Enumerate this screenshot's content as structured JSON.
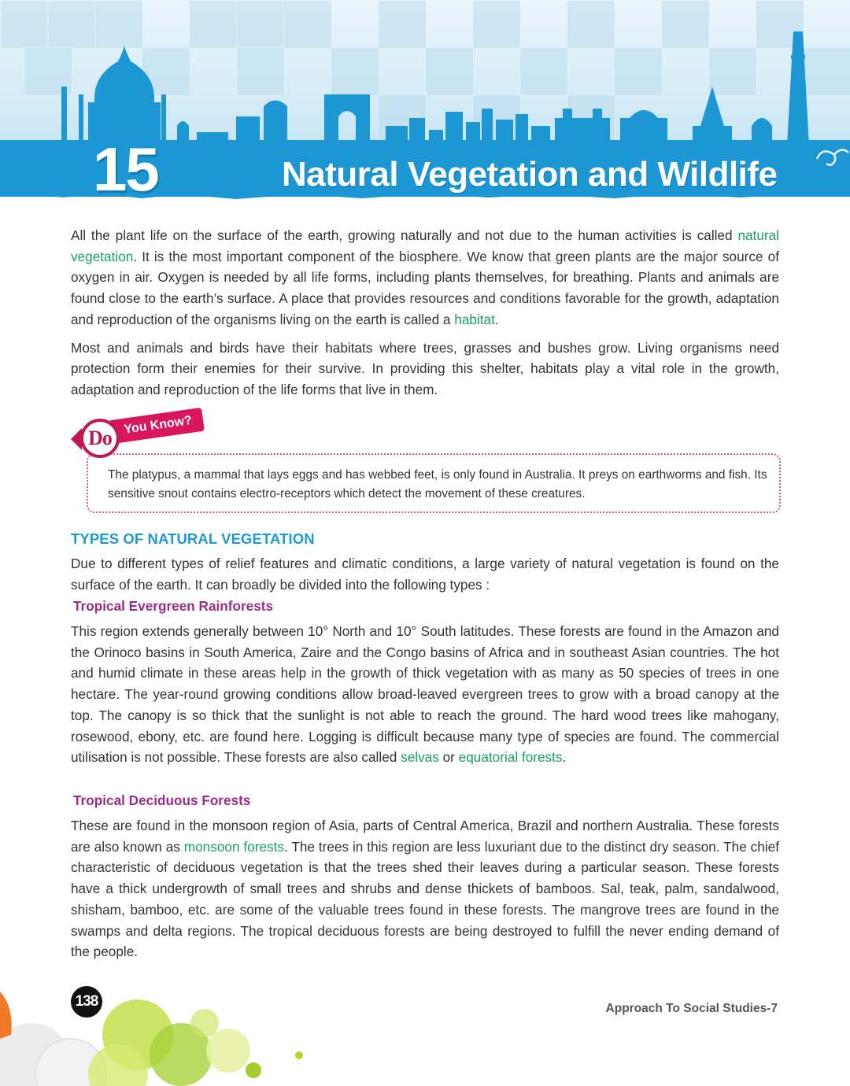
{
  "header": {
    "chapter_number": "15",
    "chapter_title": "Natural Vegetation and Wildlife"
  },
  "intro": {
    "p1_before": "All the plant life on the surface of the earth, growing naturally and not due to the human activities is called ",
    "p1_term1": "natural vegetation",
    "p1_middle": ". It is the most important component of the biosphere. We know that green plants are the major source of oxygen in air. Oxygen is needed by all life forms, including plants themselves, for breathing. Plants and animals are found close to the earth’s surface. A place that provides resources and conditions favorable for the growth, adaptation and reproduction of the organisms living on the earth is called a ",
    "p1_term2": "habitat",
    "p1_end": ".",
    "p2": "Most and animals and birds have their habitats where trees, grasses and bushes grow. Living organisms need protection form their enemies for their survive. In providing this shelter, habitats play a vital role in the growth, adaptation and reproduction of the life forms that live in them."
  },
  "do_you_know": {
    "badge_do": "Do",
    "badge_rest": "You Know?",
    "text": "The platypus, a mammal that lays eggs and has webbed feet, is only found in Australia. It preys on earthworms and fish. Its sensitive snout contains electro-receptors which detect the movement of these creatures."
  },
  "types": {
    "heading": "TYPES OF NATURAL VEGETATION",
    "intro": "Due to different types of relief features and climatic conditions, a large variety of natural vegetation is found on the surface of the earth. It can broadly be divided into the following types :",
    "tropical_evergreen": {
      "heading": "Tropical Evergreen Rainforests",
      "text_before": "This region extends generally between 10° North and 10° South latitudes. These forests are found in the Amazon and the Orinoco basins in South America, Zaire and the Congo basins of Africa and in southeast Asian countries. The hot and humid climate in these areas help in the growth of thick vegetation with as many as 50 species of trees in one hectare. The year-round growing conditions allow broad-leaved evergreen trees to grow with a broad canopy at the top. The canopy is so thick that the sunlight is not able to reach the ground. The hard wood trees like mahogany, rosewood, ebony, etc. are found here. Logging is difficult because many type of species are found. The commercial utilisation is not possible. These forests are also called ",
      "term1": "selvas",
      "text_or": " or ",
      "term2": "equatorial forests",
      "text_end": "."
    },
    "tropical_deciduous": {
      "heading": "Tropical Deciduous Forests",
      "text_before": "These are found in the monsoon region of Asia, parts of Central America, Brazil and northern Australia. These forests are also known as ",
      "term": "monsoon forests",
      "text_after": ". The trees in this region are less luxuriant due to the distinct dry season. The chief characteristic of deciduous vegetation is that the trees shed their leaves during a particular season. These forests have a thick undergrowth of small trees and shrubs and dense thickets of bamboos. Sal, teak, palm, sandalwood, shisham, bamboo, etc. are some of the valuable trees found in these forests. The mangrove trees are found in the swamps and delta regions. The tropical deciduous forests are being destroyed to fulfill the never ending demand of the people."
    }
  },
  "footer": {
    "page_number": "138",
    "book_title": "Approach To Social Studies-7"
  },
  "colors": {
    "banner_blue": "#1d97d4",
    "term_green": "#1a9f63",
    "section_blue": "#1d9ad6",
    "subheading_purple": "#9b2b8c",
    "badge_pink": "#d8165c"
  }
}
